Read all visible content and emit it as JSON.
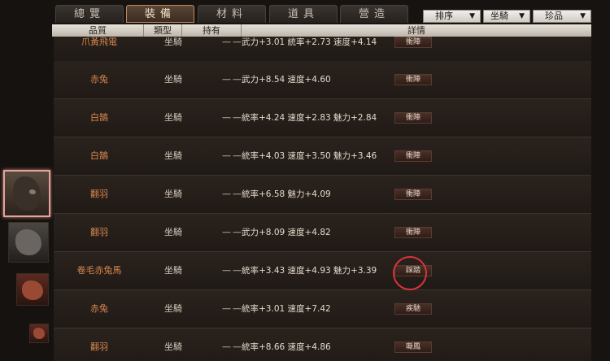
{
  "tabs": [
    "總覽",
    "裝備",
    "材料",
    "道具",
    "營造"
  ],
  "active_tab_index": 1,
  "filters": [
    {
      "label": "排序"
    },
    {
      "label": "坐騎"
    },
    {
      "label": "珍品"
    }
  ],
  "columns": [
    "品質",
    "類型",
    "持有",
    "詳情"
  ],
  "rows": [
    {
      "name": "爪黃飛電",
      "type": "坐騎",
      "owned": "——",
      "detail": "武力+3.01  統率+2.73  速度+4.14",
      "skill": "衝陣"
    },
    {
      "name": "赤兔",
      "type": "坐騎",
      "owned": "——",
      "detail": "武力+8.54  速度+4.60",
      "skill": "衝陣"
    },
    {
      "name": "白鵠",
      "type": "坐騎",
      "owned": "——",
      "detail": "統率+4.24  速度+2.83  魅力+2.84",
      "skill": "衝陣"
    },
    {
      "name": "白鵠",
      "type": "坐騎",
      "owned": "——",
      "detail": "統率+4.03  速度+3.50  魅力+3.46",
      "skill": "衝陣"
    },
    {
      "name": "翻羽",
      "type": "坐騎",
      "owned": "——",
      "detail": "統率+6.58  魅力+4.09",
      "skill": "衝陣"
    },
    {
      "name": "翻羽",
      "type": "坐騎",
      "owned": "——",
      "detail": "武力+8.09  速度+4.82",
      "skill": "衝陣"
    },
    {
      "name": "卷毛赤兔馬",
      "type": "坐騎",
      "owned": "——",
      "detail": "統率+3.43  速度+4.93  魅力+3.39",
      "skill": "踩踏"
    },
    {
      "name": "赤兔",
      "type": "坐騎",
      "owned": "——",
      "detail": "統率+3.01  速度+7.42",
      "skill": "疾馳"
    },
    {
      "name": "翻羽",
      "type": "坐騎",
      "owned": "——",
      "detail": "統率+8.66  速度+4.86",
      "skill": "嘶鳳"
    }
  ],
  "colors": {
    "accent": "#d8874e",
    "highlight_circle": "#d9343b",
    "selected_border": "#e0a49a"
  }
}
